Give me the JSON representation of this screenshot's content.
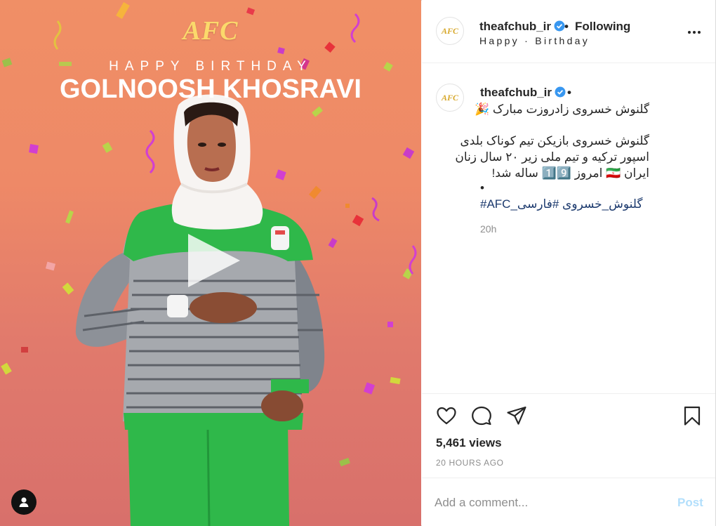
{
  "media": {
    "logo_text": "AFC",
    "headline": "HAPPY BIRTHDAY",
    "player_name": "GOLNOOSH KHOSRAVI"
  },
  "header": {
    "username": "theafchub_ir",
    "separator": "•",
    "follow_status": "Following",
    "subtitle": "Happy · Birthday"
  },
  "caption": {
    "username": "theafchub_ir",
    "separator": "•",
    "lines": [
      "گلنوش خسروی زادروزت مبارک 🎉",
      "گلنوش خسروی بازیکن تیم کوناک بلدی",
      "اسپور ترکیه و تیم ملی زیر ۲۰ سال زنان",
      "ایران 🇮🇷 امروز 1️⃣9️⃣ ساله شد!",
      "•"
    ],
    "hashtags": [
      "#AFC_گلنوش_خسروی",
      "#فارسی"
    ],
    "time_ago": "20h"
  },
  "actions": {
    "icons": [
      "heart-icon",
      "comment-icon",
      "share-icon",
      "bookmark-icon"
    ],
    "views": "5,461 views",
    "posted": "20 HOURS AGO"
  },
  "comment": {
    "placeholder": "Add a comment...",
    "post_label": "Post"
  },
  "colors": {
    "background_top": "#f08f66",
    "background_bottom": "#d8706b",
    "verified_blue": "#3897f0",
    "link": "#1c3a6e",
    "post_disabled": "#b2dffc",
    "jersey_green": "#2fb84a"
  }
}
